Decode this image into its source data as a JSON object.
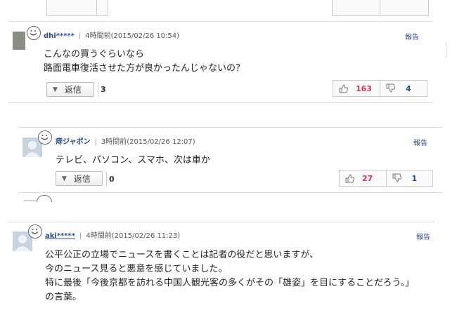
{
  "comments": [
    {
      "username": "dhi*****",
      "time": "4時間前(2015/02/26 10:54)",
      "report": "報告",
      "lines": [
        "こんなの買うぐらいなら",
        "路面電車復活させた方が良かったんじゃないの？"
      ],
      "reply_label": "返信",
      "reply_count": "3",
      "likes": "163",
      "dislikes": "4"
    },
    {
      "username": "痔ジャポン",
      "time": "3時間前(2015/02/26 12:07)",
      "report": "報告",
      "lines": [
        "テレビ、パソコン、スマホ、次は車か"
      ],
      "reply_label": "返信",
      "reply_count": "0",
      "likes": "27",
      "dislikes": "1"
    },
    {
      "username": "aki*****",
      "time": "4時間前(2015/02/26 11:23)",
      "report": "報告",
      "lines": [
        "公平公正の立場でニュースを書くことは記者の役だと思いますが、",
        "今のニュース見ると悪意を感じていました。",
        "特に最後「今後京都を訪れる中国人観光客の多くがその「雄姿」を目にすることだろう。」",
        "の言葉。"
      ]
    }
  ],
  "icons": {
    "smile": "smiley-icon",
    "up": "thumbs-up-icon",
    "down": "thumbs-down-icon",
    "reply": "triangle-down-icon"
  }
}
